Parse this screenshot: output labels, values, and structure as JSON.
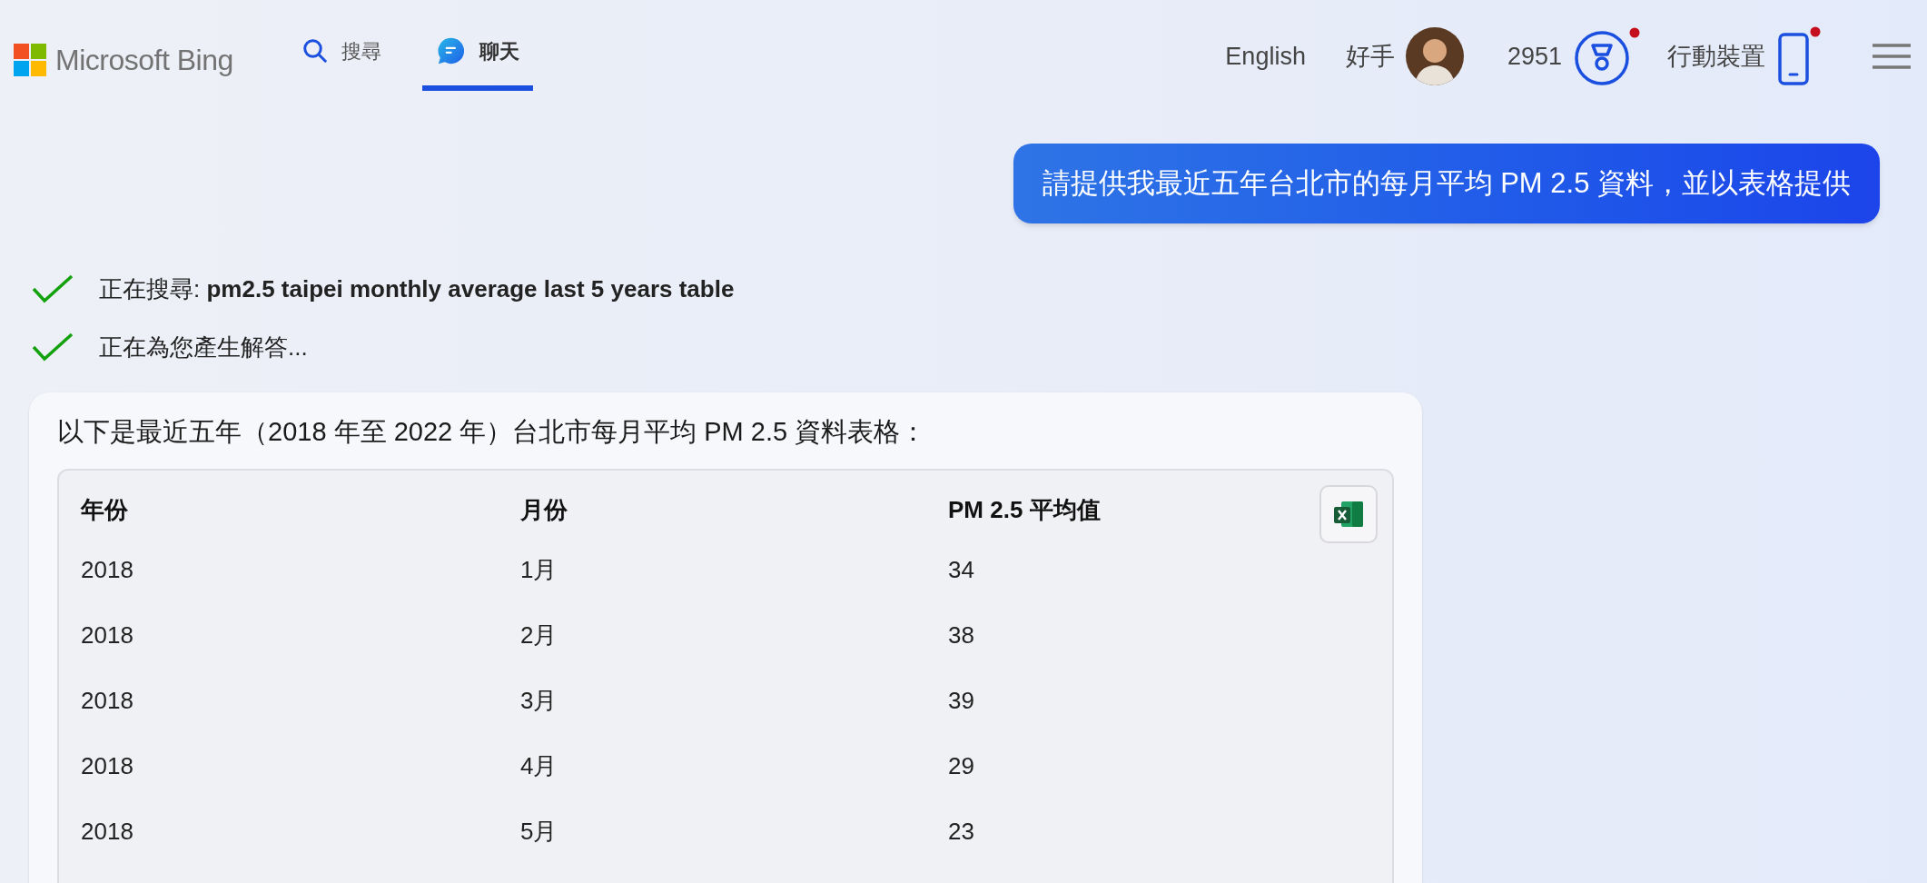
{
  "header": {
    "logo": "Microsoft Bing",
    "tabs": [
      {
        "label": "搜尋",
        "kind": "search",
        "selected": false
      },
      {
        "label": "聊天",
        "kind": "chat",
        "selected": true
      }
    ],
    "language": "English",
    "user_name": "好手",
    "points": "2951",
    "mobile": "行動裝置"
  },
  "user_message": "請提供我最近五年台北市的每月平均 PM 2.5 資料，並以表格提供",
  "status_lines": [
    {
      "text": "正在搜尋: **pm2.5 taipei monthly average last 5 years table**",
      "done": true
    },
    {
      "text": "正在為您產生解答...",
      "done": true
    }
  ],
  "answer": {
    "intro": "以下是最近五年（2018 年至 2022 年）台北市每月平均 PM 2.5 資料表格：",
    "table": {
      "columns": [
        "年份",
        "月份",
        "PM 2.5 平均值"
      ],
      "rows": [
        [
          "2018",
          "1月",
          "34"
        ],
        [
          "2018",
          "2月",
          "38"
        ],
        [
          "2018",
          "3月",
          "39"
        ],
        [
          "2018",
          "4月",
          "29"
        ],
        [
          "2018",
          "5月",
          "23"
        ]
      ]
    }
  }
}
